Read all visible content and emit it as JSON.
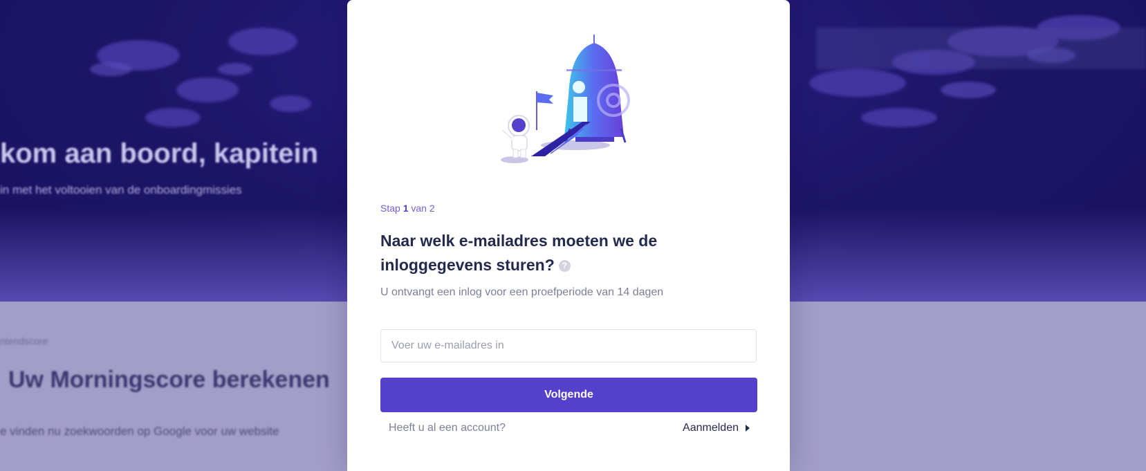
{
  "background": {
    "hero_title": "kom aan boord, kapitein",
    "hero_subtitle": "in met het voltooien van de onboardingmissies",
    "section_label": "ntendscore",
    "section_heading": "Uw Morningscore berekenen",
    "section_text": "e vinden nu zoekwoorden op Google voor uw website"
  },
  "modal": {
    "illustration_icon": "astronaut-rocket-illustration",
    "step": {
      "prefix": "Stap",
      "current": "1",
      "suffix": "van 2"
    },
    "title": "Naar welk e-mailadres moeten we de inloggegevens sturen?",
    "help_icon": "question-circle-icon",
    "help_glyph": "?",
    "subtitle": "U ontvangt een inlog voor een proefperiode van 14 dagen",
    "email_input": {
      "placeholder": "Voer uw e-mailadres in",
      "value": ""
    },
    "next_label": "Volgende",
    "account_question": "Heeft u al een account?",
    "login_label": "Aanmelden"
  },
  "colors": {
    "primary": "#5540cc",
    "title": "#232a4e",
    "muted": "#7b7f97",
    "step_accent": "#6c5fd6"
  }
}
